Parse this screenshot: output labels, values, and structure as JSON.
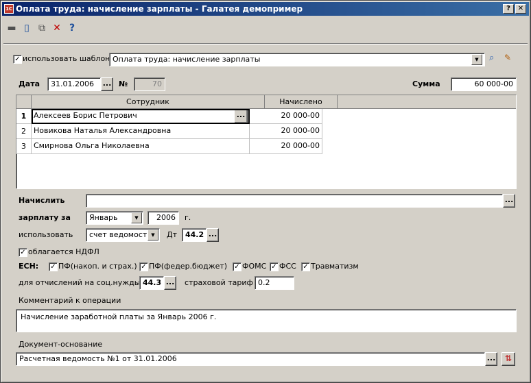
{
  "window": {
    "title": "Оплата труда: начисление зарплаты - Галатея демопример",
    "app_icon": "1C",
    "help_btn": "?",
    "close_btn": "✕"
  },
  "toolbar": {
    "icons": [
      "save-icon",
      "new-document-icon",
      "copy-icon",
      "delete-icon",
      "help-icon"
    ],
    "glyphs": [
      "▬",
      "▯",
      "⧉",
      "✕",
      "?"
    ]
  },
  "template": {
    "checkbox_label": "использовать шаблон",
    "checked": "✓",
    "value": "Оплата труда: начисление зарплаты"
  },
  "header": {
    "date_label": "Дата",
    "date_value": "31.01.2006",
    "number_label": "№",
    "number_value": "70",
    "sum_label": "Сумма",
    "sum_value": "60 000-00",
    "ellipsis": "..."
  },
  "table": {
    "columns": [
      "Сотрудник",
      "Начислено"
    ],
    "rows": [
      {
        "n": "1",
        "employee": "Алексеев Борис Петрович",
        "amount": "20 000-00"
      },
      {
        "n": "2",
        "employee": "Новикова Наталья Александровна",
        "amount": "20 000-00"
      },
      {
        "n": "3",
        "employee": "Смирнова Ольга Николаевна",
        "amount": "20 000-00"
      }
    ]
  },
  "form": {
    "accrue_label": "Начислить",
    "accrue_value": "",
    "salary_for_label": "зарплату за",
    "month_value": "Январь",
    "year_value": "2006",
    "year_suffix": "г.",
    "use_label": "использовать",
    "use_value": "счет ведомости",
    "dt_label": "Дт",
    "dt_value": "44.2",
    "ndfl_label": "облагается НДФЛ",
    "esn_label": "ЕСН:",
    "esn_items": [
      "ПФ(накоп. и страх.)",
      "ПФ(федер.бюджет)",
      "ФОМС",
      "ФСС",
      "Травматизм"
    ],
    "social_label": "для отчислений на соц.нужды",
    "social_value": "44.3",
    "tariff_label": "страховой тариф",
    "tariff_value": "0.2",
    "comment_label": "Комментарий к операции",
    "comment_value": "Начисление заработной платы за Январь 2006 г.",
    "basis_label": "Документ-основание",
    "basis_value": "Расчетная ведомость №1 от 31.01.2006"
  }
}
